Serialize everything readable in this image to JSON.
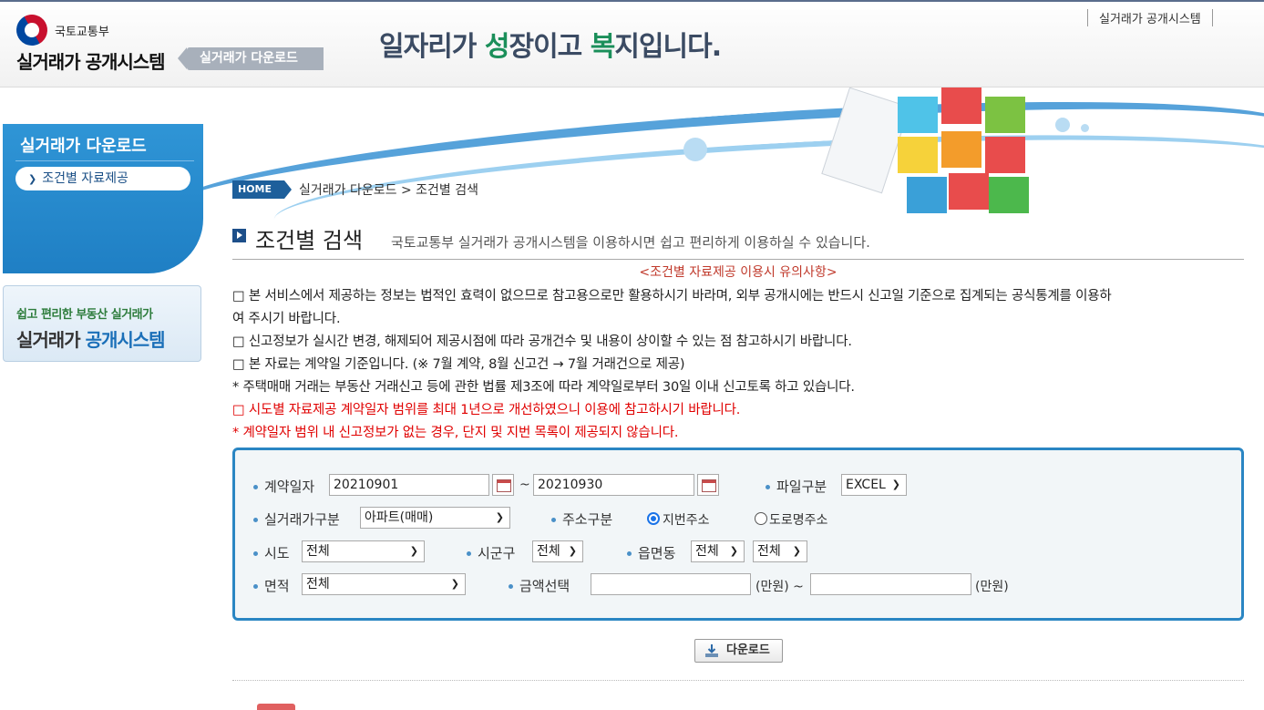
{
  "header": {
    "ministry": "국토교통부",
    "system_name": "실거래가 공개시스템",
    "section_tag": "실거래가 다운로드",
    "slogan_parts": [
      "일",
      "자리가 ",
      "성",
      "장이고 ",
      "복",
      "지입니다."
    ],
    "top_link": "실거래가 공개시스템"
  },
  "sidebar": {
    "title": "실거래가 다운로드",
    "items": [
      {
        "label": "조건별 자료제공",
        "active": true
      }
    ],
    "promo_sub": "쉽고 편리한 부동산 실거래가",
    "promo_main_a": "실거래가",
    "promo_main_b": " 공개시스템"
  },
  "breadcrumb": {
    "home": "HOME",
    "path": "실거래가 다운로드 > 조건별 검색"
  },
  "page": {
    "title": "조건별 검색",
    "description": "국토교통부 실거래가 공개시스템을 이용하시면 쉽고 편리하게 이용하실 수 있습니다."
  },
  "notice": {
    "heading": "<조건별 자료제공 이용시 유의사항>",
    "lines": [
      "□ 본 서비스에서 제공하는 정보는 법적인 효력이 없으므로 참고용으로만 활용하시기 바라며, 외부 공개시에는 반드시 신고일 기준으로 집계되는 공식통계를 이용하",
      "여 주시기 바랍니다.",
      "□ 신고정보가 실시간 변경, 해제되어 제공시점에 따라 공개건수 및 내용이 상이할 수 있는 점 참고하시기 바랍니다.",
      "□ 본 자료는 계약일 기준입니다. (※ 7월 계약, 8월 신고건 → 7월 거래건으로 제공)",
      "* 주택매매 거래는 부동산 거래신고 등에 관한 법률 제3조에 따라 계약일로부터 30일 이내 신고토록 하고 있습니다.",
      "□ 시도별 자료제공 계약일자 범위를 최대 1년으로 개선하였으니 이용에 참고하시기 바랍니다.",
      "* 계약일자 범위 내 신고정보가 없는 경우, 단지 및 지번 목록이 제공되지 않습니다."
    ]
  },
  "search": {
    "contract_date_label": "계약일자",
    "date_from": "20210901",
    "date_to": "20210930",
    "tilde": "~",
    "file_type_label": "파일구분",
    "file_type": "EXCEL",
    "deal_type_label": "실거래가구분",
    "deal_type": "아파트(매매)",
    "address_type_label": "주소구분",
    "address_option_1": "지번주소",
    "address_option_2": "도로명주소",
    "sido_label": "시도",
    "sido": "전체",
    "sigungu_label": "시군구",
    "sigungu": "전체",
    "eup_label": "읍면동",
    "eup": "전체",
    "ri": "전체",
    "area_label": "면적",
    "area": "전체",
    "amount_label": "금액선택",
    "amount_from": "",
    "amount_to": "",
    "unit_1": "(만원) ~",
    "unit_2": "(만원)"
  },
  "download_button": "다운로드",
  "colors": {
    "accent": "#2a86c3",
    "warning": "#e00000",
    "sidebar": "#2f95d6"
  }
}
